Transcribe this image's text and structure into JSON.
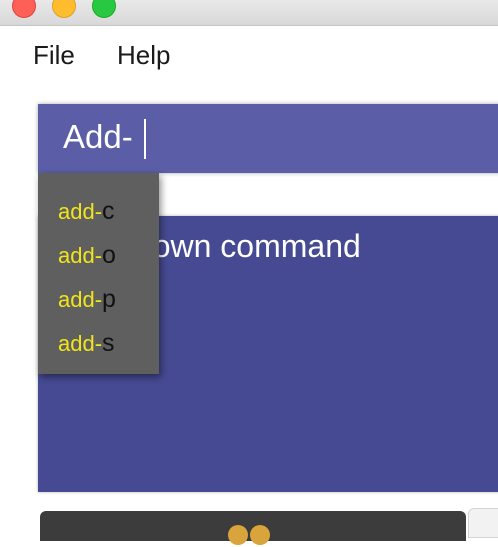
{
  "menu": {
    "file": "File",
    "help": "Help"
  },
  "command_box": {
    "value": "Add-"
  },
  "result_display": {
    "text": "Unknown command"
  },
  "autocomplete": {
    "items": [
      {
        "match": "add-",
        "rest": "c"
      },
      {
        "match": "add-",
        "rest": "o"
      },
      {
        "match": "add-",
        "rest": "p"
      },
      {
        "match": "add-",
        "rest": "s"
      }
    ]
  },
  "colors": {
    "command_box_bg": "#5b5ea6",
    "result_box_bg": "#464a92",
    "dropdown_bg": "#5f5f5f",
    "match_highlight": "#f0e51d"
  }
}
